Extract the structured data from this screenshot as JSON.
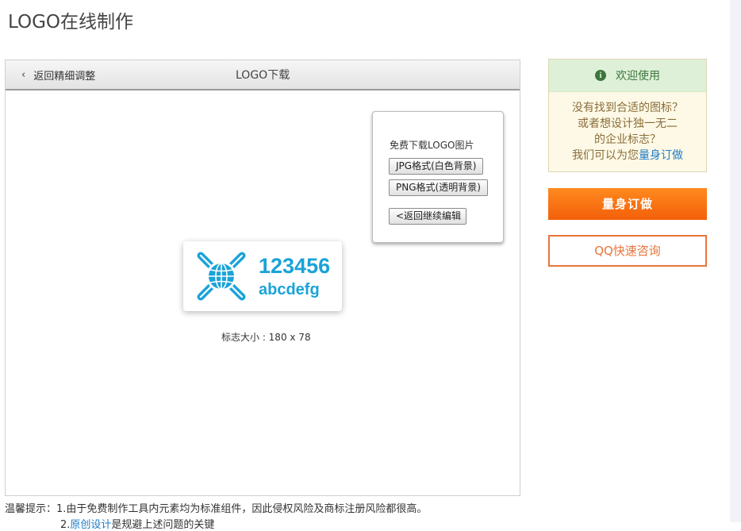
{
  "page": {
    "title": "LOGO在线制作"
  },
  "panel": {
    "back_label": "返回精细调整",
    "header_title": "LOGO下载",
    "download": {
      "label": "免费下载LOGO图片",
      "jpg_button": "JPG格式(白色背景)",
      "png_button": "PNG格式(透明背景)",
      "back_button": "<返回继续编辑"
    },
    "logo": {
      "line1": "123456",
      "line2": "abcdefg",
      "color": "#1aa3d8"
    },
    "size_label": "标志大小 : 180 x 78"
  },
  "tips": {
    "line1": "温馨提示：1.由于免费制作工具内元素均为标准组件，因此侵权风险及商标注册风险都很高。",
    "line2_prefix": "2.",
    "line2_link": "原创设计",
    "line2_suffix": "是规避上述问题的关键"
  },
  "sidebar": {
    "welcome_title": "欢迎使用",
    "welcome_lines": [
      "没有找到合适的图标？",
      "或者想设计独一无二",
      "的企业标志？"
    ],
    "welcome_last_prefix": "我们可以为您",
    "welcome_last_link": "量身订做",
    "order_button": "量身订做",
    "qq_button": "QQ快速咨询",
    "colors": {
      "accent_orange": "#f35f0a",
      "success_green": "#3c763d",
      "link_blue": "#1e7cc8"
    }
  }
}
